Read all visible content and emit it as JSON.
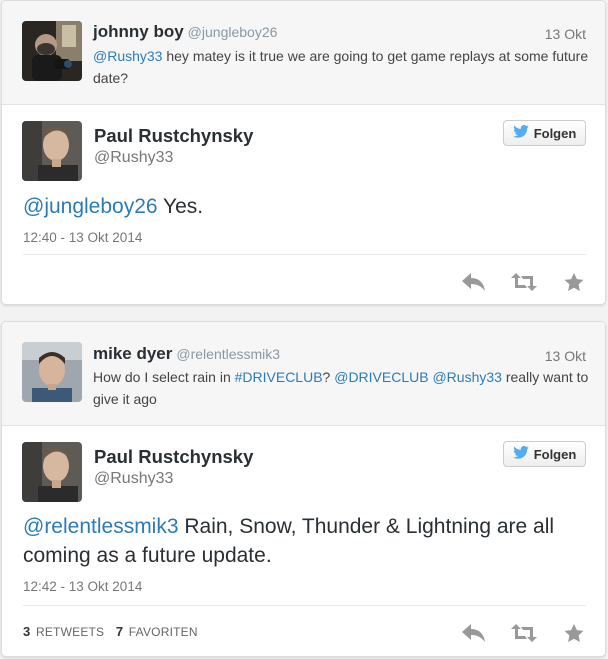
{
  "conversations": [
    {
      "reply": {
        "name": "johnny boy",
        "handle": "@jungleboy26",
        "date": "13 Okt",
        "text_mention": "@Rushy33",
        "text_rest": " hey matey is it true we are going to get game replays at some future date?"
      },
      "tweet": {
        "name": "Paul Rustchynsky",
        "handle": "@Rushy33",
        "follow_label": "Folgen",
        "text_mention": "@jungleboy26",
        "text_rest": " Yes.",
        "timestamp": "12:40 - 13 Okt 2014"
      }
    },
    {
      "reply": {
        "name": "mike dyer",
        "handle": "@relentlessmik3",
        "date": "13 Okt",
        "text_plain": "How do I select rain in ",
        "text_hashtag": "#DRIVECLUB",
        "text_mid": "?  ",
        "text_mention1": "@DRIVECLUB",
        "text_space": " ",
        "text_mention2": "@Rushy33",
        "text_end": " really want to give it ago"
      },
      "tweet": {
        "name": "Paul Rustchynsky",
        "handle": "@Rushy33",
        "follow_label": "Folgen",
        "text_mention": "@relentlessmik3",
        "text_rest": " Rain, Snow, Thunder & Lightning are all coming as a future update.",
        "timestamp": "12:42 - 13 Okt 2014",
        "retweets_count": "3",
        "retweets_label": "RETWEETS",
        "favorites_count": "7",
        "favorites_label": "FAVORITEN"
      }
    }
  ],
  "icons": {
    "reply": "reply-icon",
    "retweet": "retweet-icon",
    "favorite": "star-icon",
    "bird": "twitter-bird-icon"
  },
  "colors": {
    "link": "#2b7bb9",
    "action_icon": "#999999",
    "bird": "#55acee"
  }
}
